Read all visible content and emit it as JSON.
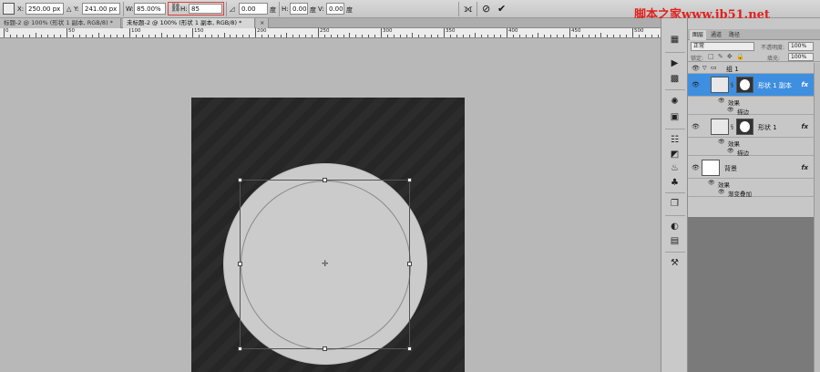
{
  "options_bar": {
    "x_label": "X:",
    "x_value": "250.00 px",
    "y_label": "Y:",
    "y_value": "241.00 px",
    "w_label": "W:",
    "w_value": "85.00%",
    "h_label": "H:",
    "h_value": "85",
    "angle_value": "0.00",
    "angle_unit": "度",
    "hskew_label": "H:",
    "hskew_value": "0.00",
    "hskew_unit": "度",
    "vskew_label": "V:",
    "vskew_value": "0.00",
    "vskew_unit": "度",
    "warp_icon": "⟗",
    "cancel_icon": "⊘",
    "commit_icon": "✔"
  },
  "watermark": "脚本之家www.jb51.net",
  "tabs": [
    {
      "label": "标题-2 @ 100% (形状 1 副本, RGB/8) *",
      "active": false
    },
    {
      "label": "未标题-2 @ 100% (形状 1 副本, RGB/8) *",
      "active": true
    },
    {
      "label": "×",
      "active": false
    }
  ],
  "ruler_labels": [
    "0",
    "50",
    "100",
    "150",
    "200",
    "250",
    "300",
    "350",
    "400",
    "450",
    "500"
  ],
  "layers_panel": {
    "tabs": [
      "图层",
      "通道",
      "路径"
    ],
    "blend_mode": "正常",
    "opacity_label": "不透明度:",
    "opacity_value": "100%",
    "lock_label": "锁定:",
    "lock_icons": "□ ✎ ✥ 🔒",
    "fill_label": "填充:",
    "fill_value": "100%",
    "group_name": "组 1",
    "layers": [
      {
        "name": "形状 1 副本",
        "fx": "fx",
        "selected": true,
        "effects_label": "效果",
        "effects": [
          "描边"
        ]
      },
      {
        "name": "形状 1",
        "fx": "fx",
        "selected": false,
        "effects_label": "效果",
        "effects": [
          "描边"
        ]
      },
      {
        "name": "背景",
        "fx": "fx",
        "selected": false,
        "effects_label": "效果",
        "effects": [
          "渐变叠加"
        ]
      }
    ]
  },
  "colors": {
    "selected_layer": "#3f8fe0",
    "canvas_bg": "#262626",
    "shape_fill": "#cbcbcb",
    "highlight_border": "#d9433a",
    "watermark": "#e0211d"
  }
}
